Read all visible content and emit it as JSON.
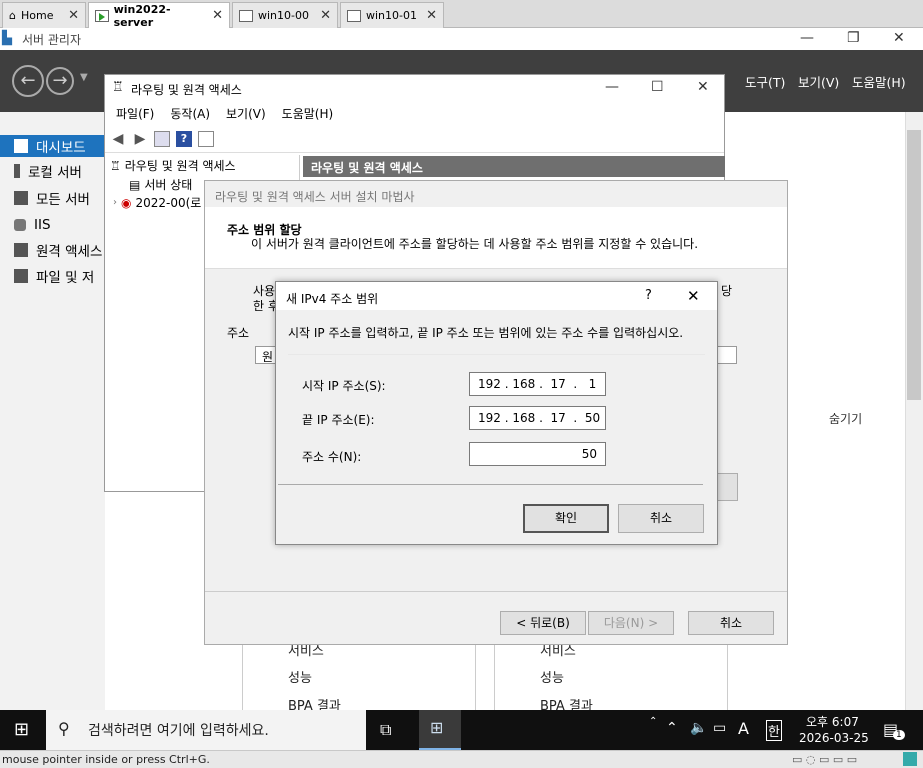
{
  "tabs": [
    {
      "label": "Home"
    },
    {
      "label": "win2022-server"
    },
    {
      "label": "win10-00"
    },
    {
      "label": "win10-01"
    }
  ],
  "server_manager": {
    "title": "서버 관리자",
    "menu": [
      "도구(T)",
      "보기(V)",
      "도움말(H)"
    ],
    "sidebar": [
      "대시보드",
      "로컬 서버",
      "모든 서버",
      "IIS",
      "원격 액세스",
      "파일 및 저"
    ],
    "tile_left": [
      "서비스",
      "성능",
      "BPA 결과"
    ],
    "tile_right": [
      "서비스",
      "성능",
      "BPA 결과"
    ],
    "hide_label": "숨기기"
  },
  "rras": {
    "title": "라우팅 및 원격 액세스",
    "menu": [
      "파일(F)",
      "동작(A)",
      "보기(V)",
      "도움말(H)"
    ],
    "tree": [
      "라우팅 및 원격 액세스",
      "서버 상태",
      "2022-00(로"
    ],
    "right_header": "라우팅 및 원격 액세스"
  },
  "wizard": {
    "title": "라우팅 및 원격 액세스 서버 설치 마법사",
    "heading": "주소 범위 할당",
    "description": "이 서버가 원격 클라이언트에 주소를 할당하는 데 사용할 주소 범위를 지정할 수 있습니다.",
    "partial_1": "사용",
    "partial_2": "한 후",
    "partial_3": "당",
    "partial_4": "주소",
    "partial_5": "원",
    "back": "< 뒤로(B)",
    "next": "다음(N) >",
    "cancel": "취소"
  },
  "ip_dialog": {
    "title": "새 IPv4 주소 범위",
    "help": "?",
    "instruction": "시작 IP 주소를 입력하고, 끝 IP 주소 또는 범위에 있는 주소 수를 입력하십시오.",
    "start_label": "시작 IP 주소(S):",
    "start_value": "192 . 168 .  17  .   1",
    "end_label": "끝 IP 주소(E):",
    "end_value": "192 . 168 .  17  .  50",
    "count_label": "주소 수(N):",
    "count_value": "50",
    "ok": "확인",
    "cancel": "취소"
  },
  "taskbar": {
    "search_placeholder": "검색하려면 여기에 입력하세요.",
    "ime_a": "A",
    "ime_han": "한",
    "time": "오후 6:07",
    "date": "2026-03-25",
    "notify_count": "1"
  },
  "statusbar": "mouse pointer inside or press Ctrl+G."
}
